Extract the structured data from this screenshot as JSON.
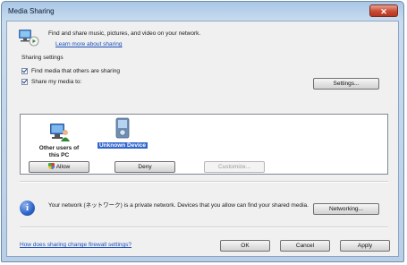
{
  "window": {
    "title": "Media Sharing",
    "close_glyph": "✕"
  },
  "header": {
    "description": "Find and share music, pictures, and video on your network.",
    "learn_more_link": "Learn more about sharing"
  },
  "sharing_settings": {
    "label": "Sharing settings",
    "find_media": {
      "label": "Find media that others are sharing",
      "checked": true
    },
    "share_media": {
      "label": "Share my media to:",
      "checked": true
    },
    "settings_button": "Settings..."
  },
  "devices": [
    {
      "label": "Other users of this PC",
      "label_line1": "Other users of",
      "label_line2": "this PC",
      "icon": "users-computer-icon",
      "selected": false
    },
    {
      "label": "Unknown Device",
      "icon": "media-device-icon",
      "selected": true
    }
  ],
  "actions": {
    "allow": "Allow",
    "deny": "Deny",
    "customize": "Customize..."
  },
  "network_info": {
    "text": "Your network (ネットワーク) is a private network. Devices that you allow can find your shared media.",
    "networking_button": "Networking..."
  },
  "footer": {
    "firewall_link": "How does sharing change firewall settings?",
    "ok": "OK",
    "cancel": "Cancel",
    "apply": "Apply"
  }
}
